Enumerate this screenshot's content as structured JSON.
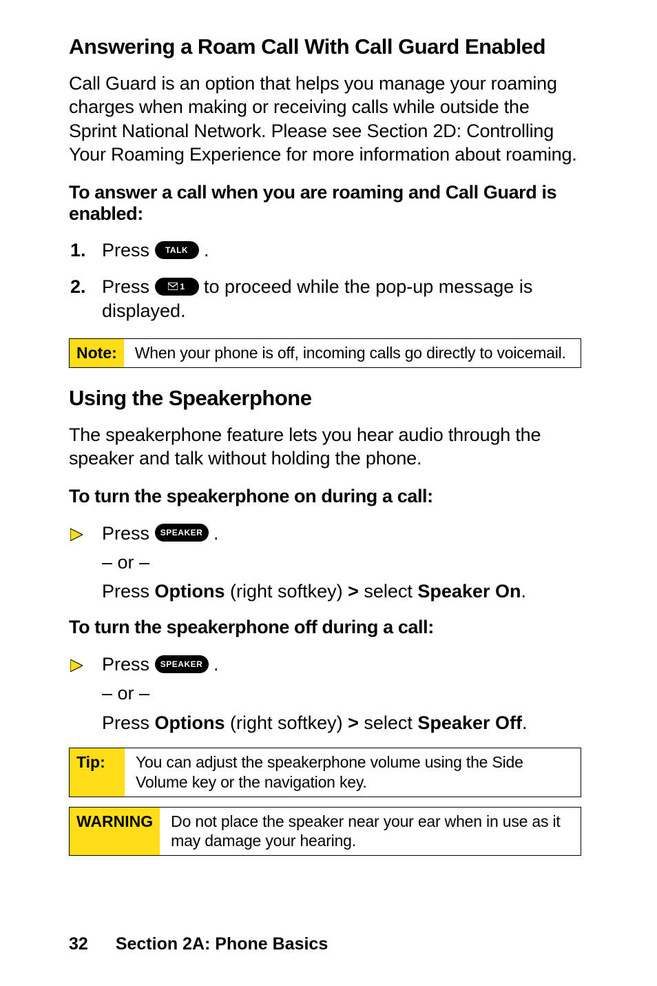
{
  "section1": {
    "heading": "Answering a Roam Call With Call Guard Enabled",
    "body": "Call Guard is an option that helps you manage your roaming charges when making or receiving calls while outside the Sprint National Network. Please see Section 2D: Controlling Your Roaming Experience for more information about roaming.",
    "leadin": "To answer a call when you are roaming and Call Guard is enabled:",
    "step1_num": "1.",
    "step1_a": "Press ",
    "step1_key": "TALK",
    "step1_b": " .",
    "step2_num": "2.",
    "step2_a": "Press ",
    "step2_key": "1",
    "step2_b": " to proceed while the pop-up message is displayed."
  },
  "note": {
    "label": "Note:",
    "text": "When your phone is off, incoming calls go directly to voicemail."
  },
  "section2": {
    "heading": "Using the Speakerphone",
    "body": "The speakerphone feature lets you hear audio through the speaker and talk without holding the phone.",
    "leadin_on": "To turn the speakerphone on during a call:",
    "leadin_off": "To turn the speakerphone off during a call:",
    "press": "Press ",
    "speaker_key": "SPEAKER",
    "period": " .",
    "or": "– or –",
    "opt_a": "Press ",
    "opt_b": "Options",
    "opt_c": " (right softkey) ",
    "opt_chev": ">",
    "opt_d": " select ",
    "opt_on": "Speaker On",
    "opt_off": "Speaker Off",
    "opt_end": "."
  },
  "tip": {
    "label": "Tip:",
    "text": "You can adjust the speakerphone volume using the Side Volume key or the navigation key."
  },
  "warning": {
    "label": "WARNING",
    "text": "Do not place the speaker near your ear when in use as it may damage your hearing."
  },
  "footer": {
    "page": "32",
    "title": "Section 2A: Phone Basics"
  }
}
